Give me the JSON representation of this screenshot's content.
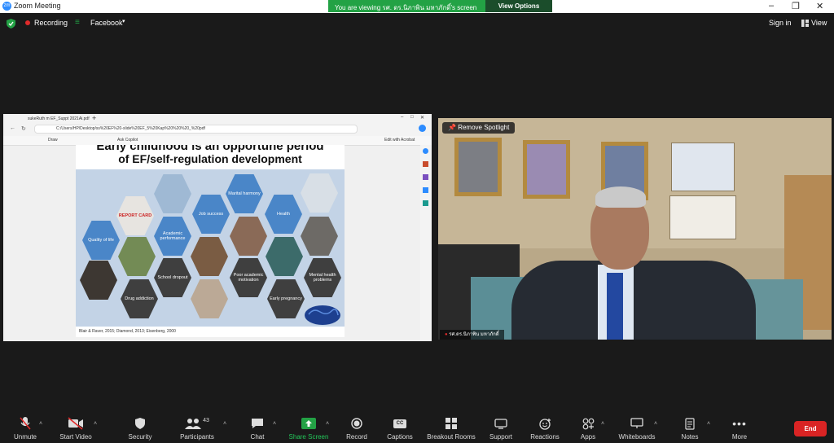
{
  "window": {
    "title": "Zoom Meeting",
    "logo": "zm"
  },
  "share_banner": {
    "text": "You are viewing รศ. ดร.นิภาพิน มหาภักดิ์'s screen",
    "view_options": "View Options"
  },
  "toolbar_top": {
    "recording": "Recording",
    "facebook": "Facebook",
    "sign_in": "Sign in",
    "view": "View"
  },
  "browser": {
    "tab_title": "sukeRuth m EF_Suppt 2021Ai.pdf",
    "address": "C:/Users/HP/Desktop/ss%20EF%20-slide%20EF_5%20Kap%20%20%20_%20pdf",
    "draw_label": "Draw",
    "read_aloud": "Ask Copilot",
    "edit_acrobat": "Edit with Acrobat"
  },
  "slide": {
    "title_line1": "Early childhood is an opportune period",
    "title_line2": "of EF/self-regulation development",
    "citation": "Blair & Raver, 2015; Diamond, 2013; Eisenberg, 2000",
    "report_card_text": "REPORT CARD",
    "hexagons": [
      "Marital harmony",
      "Job success",
      "Health",
      "Quality of life",
      "Academic performance",
      "School dropout",
      "Poor academic motivation",
      "Mental health problems",
      "Drug addiction",
      "Early pregnancy"
    ]
  },
  "video": {
    "remove_spotlight": "Remove Spotlight",
    "name": "รศ.ดร.นิภาพิน มหาภักดิ์"
  },
  "bottom": {
    "unmute": "Unmute",
    "start_video": "Start Video",
    "security": "Security",
    "participants": "Participants",
    "participants_count": "43",
    "chat": "Chat",
    "share_screen": "Share Screen",
    "record": "Record",
    "captions": "Captions",
    "captions_icon_text": "CC",
    "breakout": "Breakout Rooms",
    "support": "Support",
    "reactions": "Reactions",
    "apps": "Apps",
    "whiteboards": "Whiteboards",
    "notes": "Notes",
    "more": "More",
    "end": "End"
  },
  "colors": {
    "share_green": "#23a245",
    "end_red": "#d92424",
    "zoom_blue": "#2d8cff"
  }
}
